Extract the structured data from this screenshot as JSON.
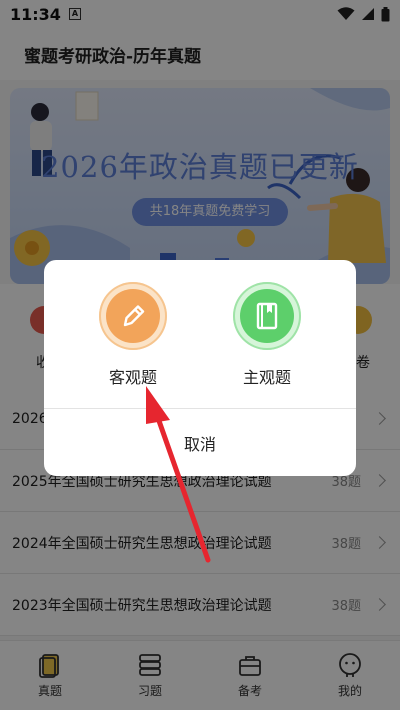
{
  "status": {
    "time": "11:34",
    "notif_letter": "A"
  },
  "header": {
    "title": "蜜题考研政治-历年真题"
  },
  "banner": {
    "headline": "2026年政治真题已更新",
    "pill": "共18年真题免费学习"
  },
  "icon_row": {
    "left_peek": "收",
    "right_peek": "卷"
  },
  "list": [
    {
      "title": "2026",
      "count": ""
    },
    {
      "title": "2025年全国硕士研究生思想政治理论试题",
      "count": "38题"
    },
    {
      "title": "2024年全国硕士研究生思想政治理论试题",
      "count": "38题"
    },
    {
      "title": "2023年全国硕士研究生思想政治理论试题",
      "count": "38题"
    }
  ],
  "tabs": [
    {
      "label": "真题",
      "icon": "book-icon"
    },
    {
      "label": "习题",
      "icon": "stack-icon"
    },
    {
      "label": "备考",
      "icon": "briefcase-icon"
    },
    {
      "label": "我的",
      "icon": "face-icon"
    }
  ],
  "dialog": {
    "option_objective": "客观题",
    "option_subjective": "主观题",
    "cancel": "取消"
  },
  "colors": {
    "objective": "#f2a45a",
    "subjective": "#5dcf6b",
    "arrow": "#e6262f"
  }
}
